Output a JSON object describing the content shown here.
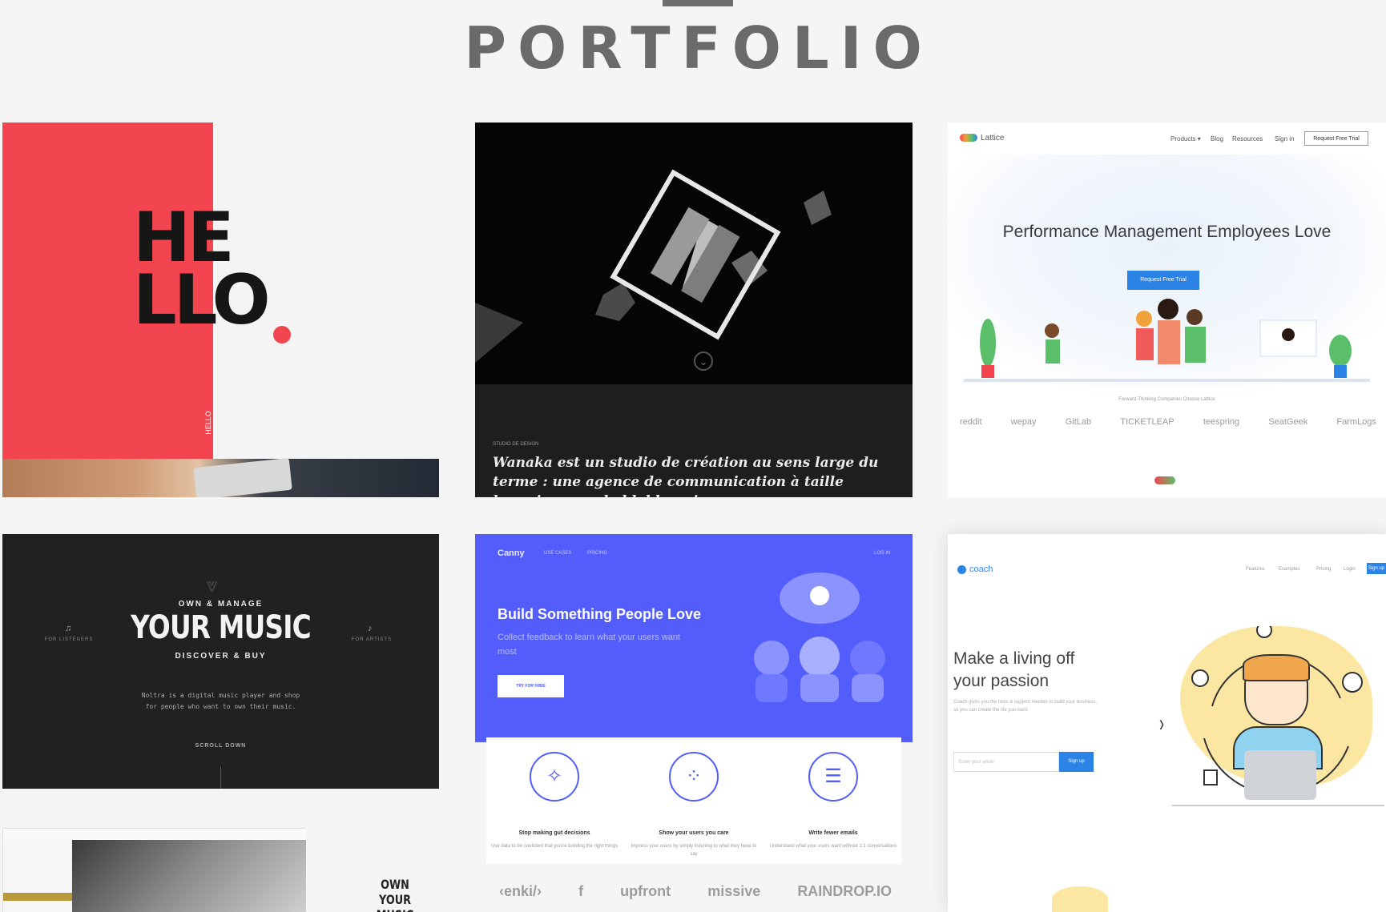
{
  "header": {
    "title": "PORTFOLIO"
  },
  "tiles": {
    "hello": {
      "line1": "HE",
      "line2": "LLO",
      "vertical_label": "HELLO"
    },
    "wanaka": {
      "small_label": "STUDIO DE DESIGN",
      "description": "Wanaka est un studio de création au sens large du terme : une agence de communication à taille humaine sans le blabla qui va",
      "scroll_glyph": "⌄"
    },
    "lattice": {
      "logo": "Lattice",
      "nav": [
        "Products ▾",
        "Blog",
        "Resources",
        "Sign in"
      ],
      "nav_button": "Request Free Trial",
      "headline": "Performance Management Employees Love",
      "cta": "Request Free Trial",
      "tagline": "Forward-Thinking Companies Choose Lattice",
      "logos": [
        "reddit",
        "wepay",
        "GitLab",
        "TICKETLEAP",
        "teespring",
        "SeatGeek",
        "FarmLogs"
      ]
    },
    "music": {
      "kicker": "OWN & MANAGE",
      "headline": "YOUR MUSIC",
      "subhead": "DISCOVER & BUY",
      "left_label": "FOR LISTENERS",
      "right_label": "FOR ARTISTS",
      "description": "Noltra is a digital music player and shop for people who want to own their music.",
      "scroll": "SCROLL DOWN",
      "secondary_title": "OWN YOUR MUSIC"
    },
    "canny": {
      "logo": "Canny",
      "nav": [
        "USE CASES",
        "PRICING"
      ],
      "login": "LOG IN",
      "headline": "Build Something People Love",
      "subhead": "Collect feedback to learn what your users want most",
      "cta": "TRY FOR FREE",
      "features": [
        {
          "icon": "compass-icon",
          "glyph": "✧",
          "title": "Stop making gut decisions",
          "text": "Use data to be confident that you're building the right things"
        },
        {
          "icon": "dots-icon",
          "glyph": "⁘",
          "title": "Show your users you care",
          "text": "Impress your users by simply listening to what they have to say"
        },
        {
          "icon": "chat-icon",
          "glyph": "☰",
          "title": "Write fewer emails",
          "text": "Understand what your users want without 1:1 conversations"
        }
      ],
      "logos": [
        "‹enki/›",
        "f",
        "upfront",
        "missive",
        "RAINDROP.IO"
      ]
    },
    "coach": {
      "logo": "coach",
      "nav": [
        "Features",
        "Examples",
        "Pricing",
        "Login"
      ],
      "signup": "Sign up",
      "headline": "Make a living off your passion",
      "subhead": "Coach gives you the tools & support needed to build your business, so you can create the life you want.",
      "email_placeholder": "Enter your email",
      "cta": "Sign up",
      "next_glyph": "›",
      "laptop_glyph": ""
    }
  },
  "colors": {
    "accent_red": "#f2454f",
    "canny_blue": "#525dfb",
    "lattice_blue": "#2c83e6",
    "title_gray": "#6a6a6a"
  }
}
